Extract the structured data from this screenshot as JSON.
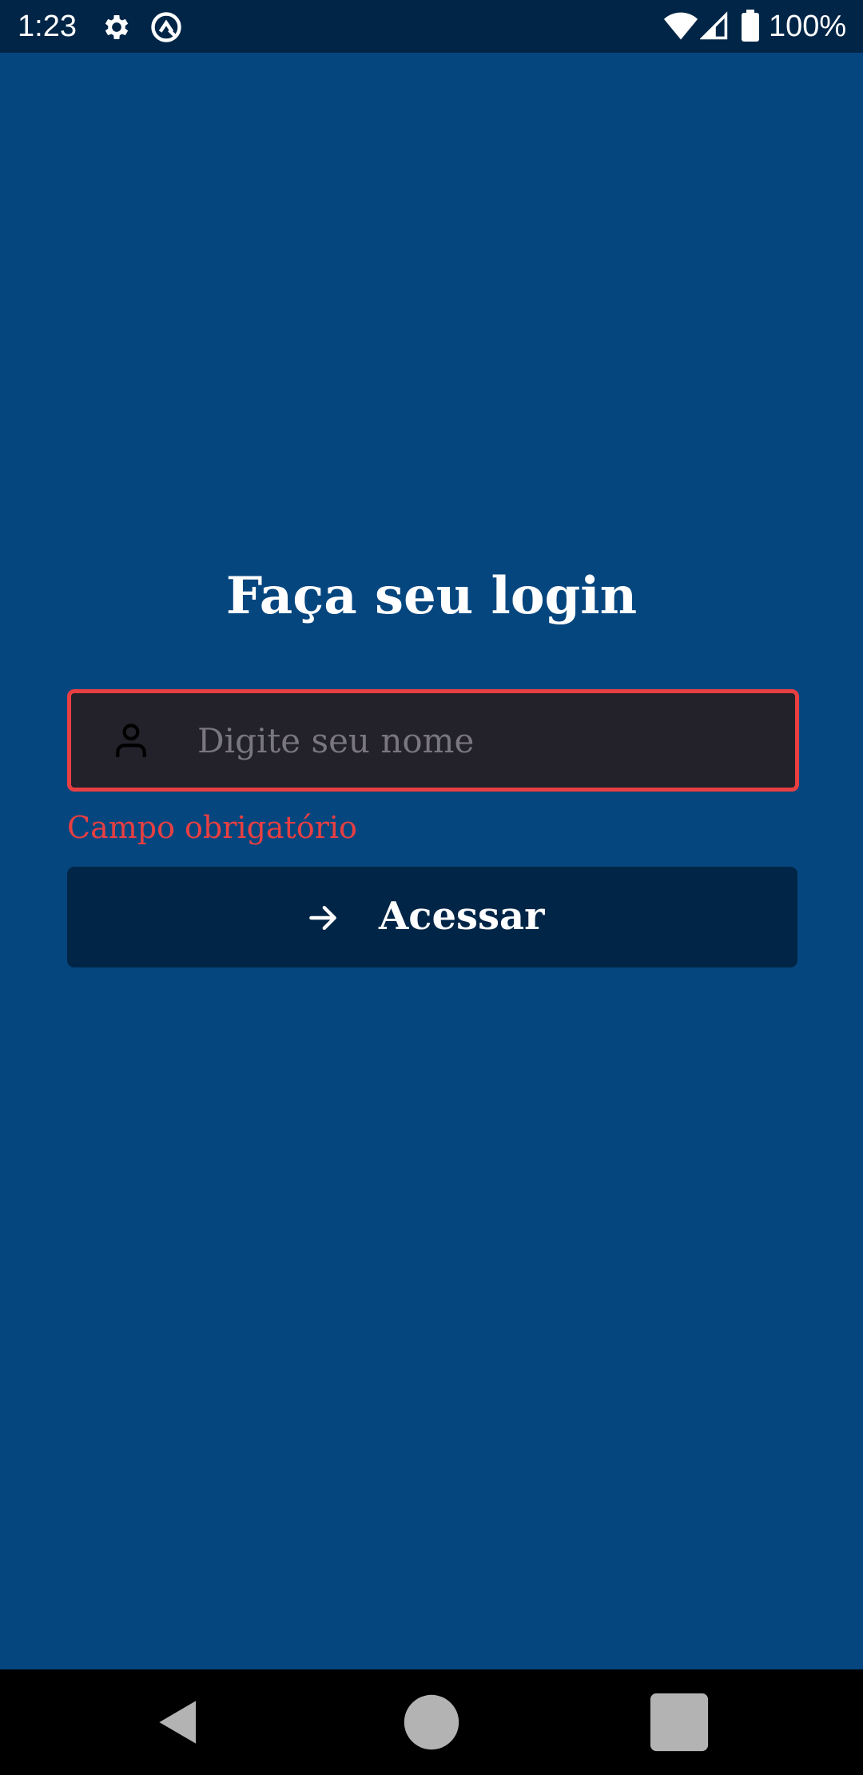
{
  "status_bar": {
    "time": "1:23",
    "battery": "100%",
    "icons": [
      "gear-icon",
      "vpn-icon",
      "wifi-icon",
      "signal-icon",
      "battery-icon"
    ]
  },
  "login": {
    "title": "Faça seu login",
    "name_field": {
      "placeholder": "Digite seu nome",
      "value": "",
      "icon": "user-icon"
    },
    "error": "Campo obrigatório",
    "submit": {
      "label": "Acessar",
      "icon": "arrow-right-icon"
    }
  },
  "nav_bar": {
    "buttons": [
      "back-icon",
      "home-icon",
      "recents-icon"
    ]
  },
  "colors": {
    "background": "#06467F",
    "status_bar": "#002546",
    "input_bg": "#232129",
    "error": "#E83F42",
    "button_bg": "#002546",
    "text": "#FFFFFF",
    "placeholder": "#79767F"
  }
}
